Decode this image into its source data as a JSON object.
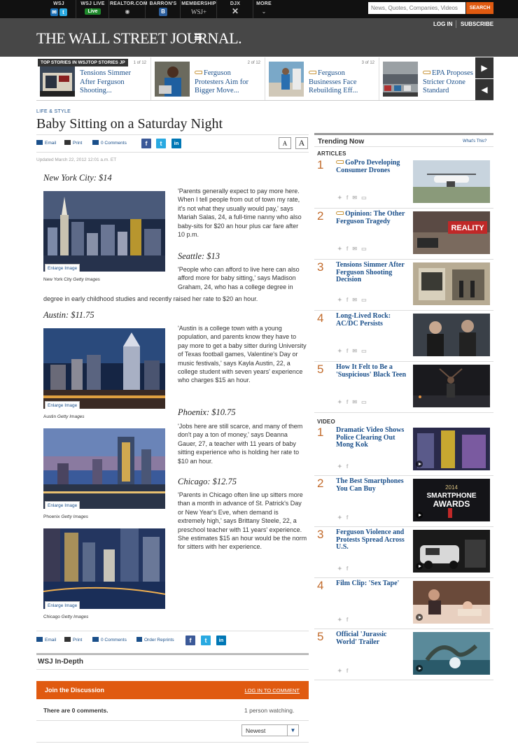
{
  "topnav": {
    "items": [
      {
        "label": "WSJ",
        "sub": ""
      },
      {
        "label": "WSJ LIVE",
        "sub": "Live"
      },
      {
        "label": "REALTOR.COM",
        "sub": ""
      },
      {
        "label": "BARRON'S",
        "sub": "B"
      },
      {
        "label": "MEMBERSHIP",
        "sub": "WSJ+"
      },
      {
        "label": "DJX",
        "sub": "✕"
      },
      {
        "label": "MORE",
        "sub": "⌄"
      }
    ],
    "search_placeholder": "News, Quotes, Companies, Videos",
    "search_label": "SEARCH"
  },
  "masthead": {
    "logo": "THE WALL STREET JOURNAL.",
    "login": "LOG IN",
    "subscribe": "SUBSCRIBE"
  },
  "top_stories": {
    "label": "TOP STORIES IN WSJTOP STORIES JP",
    "cards": [
      {
        "count": "1 of 12",
        "headline": "Tensions Simmer After Ferguson Shooting...",
        "member": false
      },
      {
        "count": "2 of 12",
        "headline": "Ferguson Protesters Aim for Bigger Move...",
        "member": true
      },
      {
        "count": "3 of 12",
        "headline": "Ferguson Businesses Face Rebuilding Eff...",
        "member": true
      },
      {
        "count": "",
        "headline": "EPA Proposes Stricter Ozone Standard",
        "member": true
      }
    ],
    "next": "▶",
    "prev": "◀"
  },
  "article": {
    "section": "LIFE & STYLE",
    "title": "Baby Sitting on a Saturday Night",
    "tools": {
      "email": "Email",
      "print": "Print",
      "comments": "0 Comments",
      "reprints": "Order Reprints"
    },
    "font_small": "A",
    "font_large": "A",
    "updated": "Updated March 22, 2012 12:01 a.m. ET",
    "enlarge": "Enlarge Image",
    "cities": [
      {
        "heading": "New York City: $14",
        "text": "'Parents generally expect to pay more here. When I tell people from out of town my rate, it's not what they usually would pay,' says Mariah Salas, 24, a full-time nanny who also baby-sits for $20 an hour plus car fare after 10 p.m."
      },
      {
        "heading": "Seattle: $13",
        "text": "'People who can afford to live here can also afford more for baby sitting,' says Madison Graham, 24, who has a college degree in early childhood studies and recently raised her rate to $20 an hour."
      },
      {
        "heading": "Austin: $11.75",
        "text": "'Austin is a college town with a young population, and parents know they have to pay more to get a baby sitter during University of Texas football games, Valentine's Day or music festivals,' says Kayla Austin, 22, a college student with seven years' experience who charges $15 an hour."
      },
      {
        "heading": "Phoenix: $10.75",
        "text": "'Jobs here are still scarce, and many of them don't pay a ton of money,' says Deanna Gauer, 27, a teacher with 11 years of baby sitting experience who is holding her rate to $10 an hour."
      },
      {
        "heading": "Chicago: $12.75",
        "text": "'Parents in Chicago often line up sitters more than a month in advance of St. Patrick's Day or New Year's Eve, when demand is extremely high,' says Brittany Steele, 22, a preschool teacher with 11 years' experience. She estimates $15 an hour would be the norm for sitters with her experience."
      }
    ],
    "captions": [
      {
        "place": "New York City",
        "credit": "Getty Images"
      },
      {
        "place": "Austin",
        "credit": "Getty Images"
      },
      {
        "place": "Phoenix",
        "credit": "Getty Images"
      },
      {
        "place": "Chicago",
        "credit": "Getty Images"
      }
    ],
    "seattle_tail": "degree in early childhood studies and recently raised her rate to $20 an hour."
  },
  "indepth": {
    "title": "WSJ In-Depth"
  },
  "discussion": {
    "title": "Join the Discussion",
    "login": "LOG IN TO COMMENT",
    "count": "There are 0 comments.",
    "watching": "1 person watching.",
    "sort": "Newest"
  },
  "trending": {
    "title": "Trending Now",
    "whats_this": "What's This?",
    "articles_label": "ARTICLES",
    "video_label": "VIDEO",
    "articles": [
      {
        "num": "1",
        "headline": "GoPro Developing Consumer Drones",
        "member": true
      },
      {
        "num": "2",
        "headline": "Opinion: The Other Ferguson Tragedy",
        "member": true
      },
      {
        "num": "3",
        "headline": "Tensions Simmer After Ferguson Shooting Decision",
        "member": false
      },
      {
        "num": "4",
        "headline": "Long-Lived Rock: AC/DC Persists",
        "member": false
      },
      {
        "num": "5",
        "headline": "How It Felt to Be a 'Suspicious' Black Teen",
        "member": false
      }
    ],
    "videos": [
      {
        "num": "1",
        "headline": "Dramatic Video Shows Police Clearing Out Mong Kok"
      },
      {
        "num": "2",
        "headline": "The Best Smartphones You Can Buy"
      },
      {
        "num": "3",
        "headline": "Ferguson Violence and Protests Spread Across U.S."
      },
      {
        "num": "4",
        "headline": "Film Clip: 'Sex Tape'"
      },
      {
        "num": "5",
        "headline": "Official 'Jurassic World' Trailer"
      }
    ],
    "awards_text_1": "SMARTPHONE",
    "awards_text_2": "AWARDS",
    "awards_year": "2014",
    "reality_text": "REALITY"
  },
  "colors": {
    "brand_orange": "#e05a10",
    "link_blue": "#1a4f8a",
    "rank_orange": "#c26b2c",
    "masthead": "#474747"
  }
}
